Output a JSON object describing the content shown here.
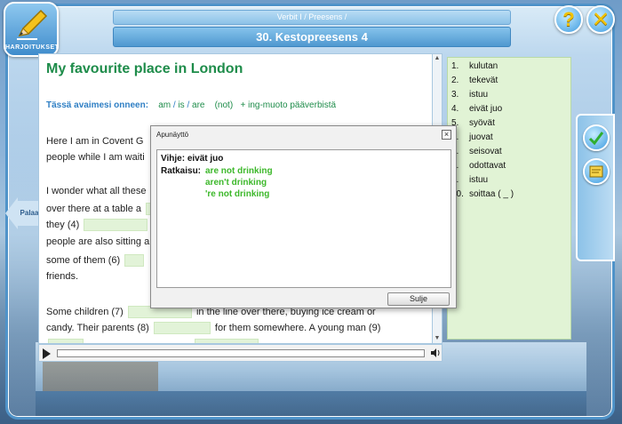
{
  "header": {
    "subtitle": "Verbit I / Preesens /",
    "title": "30. Kestopreesens 4"
  },
  "logo": {
    "label": "HARJOITUKSET"
  },
  "nav": {
    "back_label": "Palaa"
  },
  "document": {
    "title": "My favourite place in London",
    "hint_prefix": "Tässä avaimesi onneen:",
    "hint_words": [
      "am",
      "is",
      "are"
    ],
    "hint_not": "(not)",
    "hint_suffix": "+ ing-muoto pääverbistä",
    "lines": {
      "l1": "Here I am in Covent G",
      "l2": "people while I am waiti",
      "l3": "I wonder what all these",
      "l4": "over there at a table a",
      "l5a": "they (4)",
      "l6": "people are also sitting a",
      "l7a": "some of them (6)",
      "l8": "friends.",
      "l9a": "Some children (7)",
      "l9b": "in the line over there, buying ice cream or",
      "l10a": "candy. Their parents (8)",
      "l10b": "for them somewhere. A young man (9)"
    }
  },
  "answers": [
    {
      "num": "1.",
      "text": "kulutan"
    },
    {
      "num": "2.",
      "text": "tekevät"
    },
    {
      "num": "3.",
      "text": "istuu"
    },
    {
      "num": "4.",
      "text": "eivät juo"
    },
    {
      "num": "5.",
      "text": "syövät"
    },
    {
      "num": "6.",
      "text": "juovat"
    },
    {
      "num": "7.",
      "text": "seisovat"
    },
    {
      "num": "8.",
      "text": "odottavat"
    },
    {
      "num": "9.",
      "text": "istuu"
    },
    {
      "num": "10.",
      "text": "soittaa ( _ )"
    }
  ],
  "dialog": {
    "title": "Apunäyttö",
    "hint_label": "Vihje: eivät juo",
    "solution_label": "Ratkaisu:",
    "solutions": [
      "are not drinking",
      "aren't drinking",
      "'re not drinking"
    ],
    "button_label": "Sulje",
    "close_glyph": "×"
  },
  "icons": {
    "help": "?",
    "close": "✕"
  }
}
